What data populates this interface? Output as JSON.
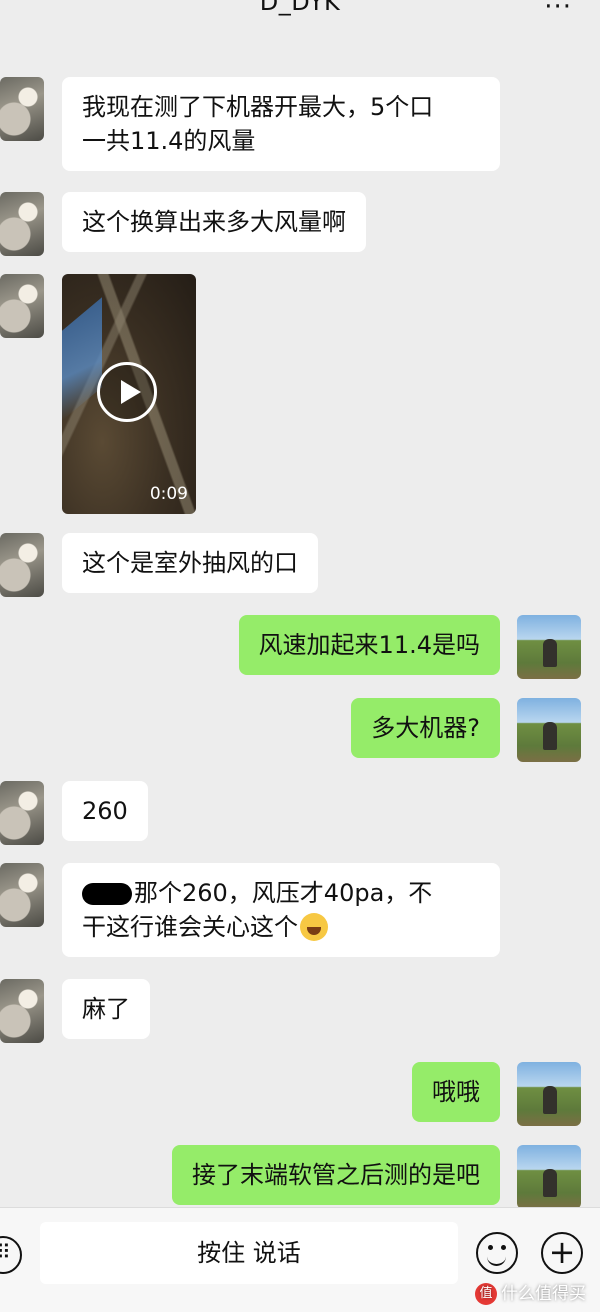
{
  "header": {
    "title": "D_DYK",
    "more_icon": "ellipsis-icon"
  },
  "messages": [
    {
      "from": "other",
      "type": "text",
      "text": "我现在测了下机器开最大，5个口\n一共11.4的风量"
    },
    {
      "from": "other",
      "type": "text",
      "text": "这个换算出来多大风量啊"
    },
    {
      "from": "other",
      "type": "video",
      "duration": "0:09"
    },
    {
      "from": "other",
      "type": "text",
      "text": "这个是室外抽风的口"
    },
    {
      "from": "self",
      "type": "text",
      "text": "风速加起来11.4是吗"
    },
    {
      "from": "self",
      "type": "text",
      "text": "多大机器?"
    },
    {
      "from": "other",
      "type": "text",
      "text": "260"
    },
    {
      "from": "other",
      "type": "text",
      "text_line1": "那个260，风压才40pa，不",
      "text_line2": "干这行谁会关心这个"
    },
    {
      "from": "other",
      "type": "text",
      "text": "麻了"
    },
    {
      "from": "self",
      "type": "text",
      "text": "哦哦"
    },
    {
      "from": "self",
      "type": "text",
      "text": "接了末端软管之后测的是吧"
    }
  ],
  "input_bar": {
    "voice_label": "按住 说话"
  },
  "watermark": {
    "logo": "值",
    "text": "什么值得买"
  },
  "colors": {
    "background": "#ededed",
    "incoming_bubble": "#ffffff",
    "outgoing_bubble": "#95ec69"
  }
}
